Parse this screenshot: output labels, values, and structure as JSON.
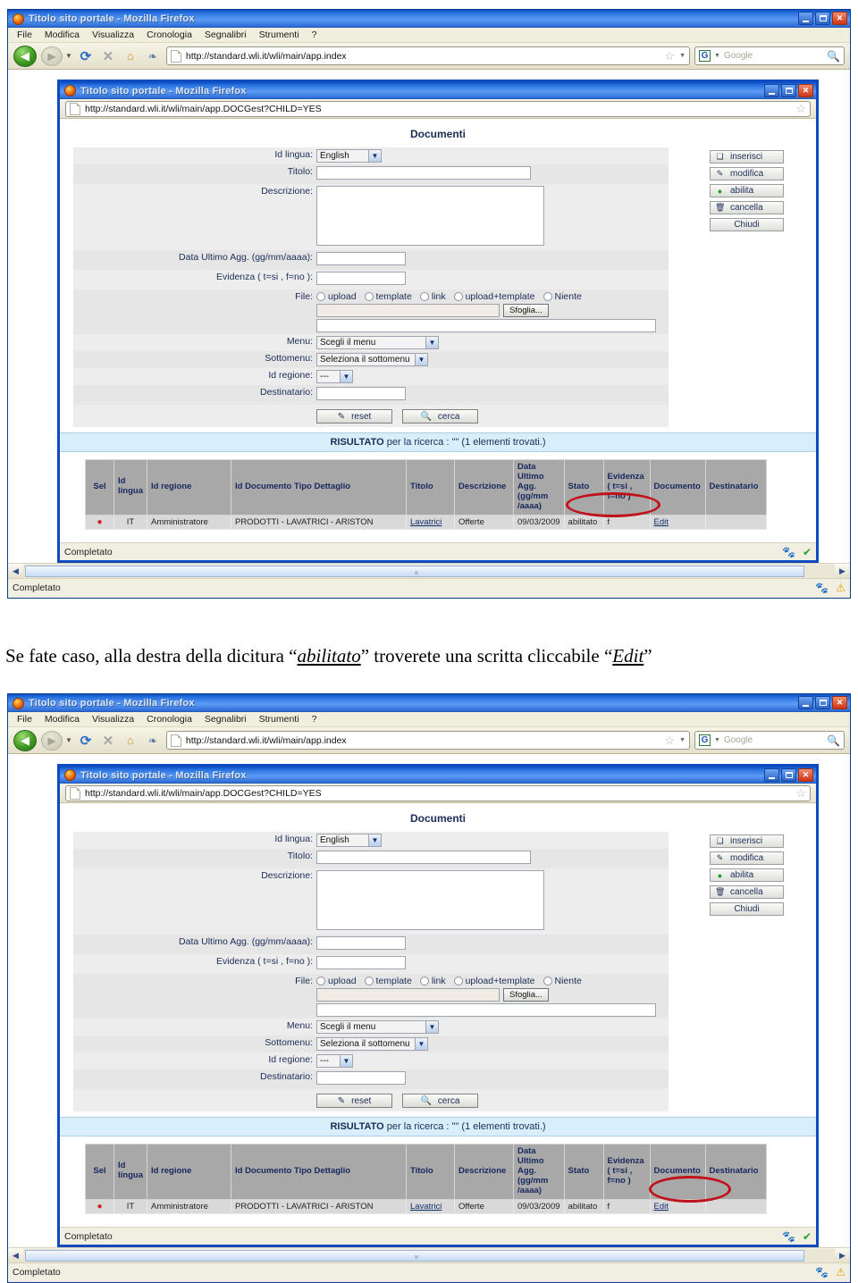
{
  "browser": {
    "window_title": "Titolo sito portale - Mozilla Firefox",
    "menubar": [
      "File",
      "Modifica",
      "Visualizza",
      "Cronologia",
      "Segnalibri",
      "Strumenti",
      "?"
    ],
    "url": "http://standard.wli.it/wli/main/app.index",
    "search_placeholder": "Google",
    "status_text": "Completato",
    "nav_icons": {
      "back": "back-arrow-icon",
      "forward": "forward-arrow-icon",
      "reload": "reload-icon",
      "stop": "stop-icon",
      "home": "home-icon",
      "bookmarks": "bookmarks-icon",
      "star": "star-icon",
      "search": "magnifier-icon",
      "throbber": "throbber-icon"
    },
    "window_buttons": [
      "minimize",
      "maximize",
      "close"
    ]
  },
  "popup": {
    "window_title": "Titolo sito portale - Mozilla Firefox",
    "url": "http://standard.wli.it/wli/main/app.DOCGest?CHILD=YES",
    "status_text": "Completato"
  },
  "page": {
    "heading": "Documenti",
    "form": {
      "fields": [
        {
          "label": "Id lingua:",
          "type": "select",
          "value": "English"
        },
        {
          "label": "Titolo:",
          "type": "text",
          "value": ""
        },
        {
          "label": "Descrizione:",
          "type": "textarea",
          "value": ""
        },
        {
          "label": "Data Ultimo Agg. (gg/mm/aaaa):",
          "type": "text",
          "value": ""
        },
        {
          "label": "Evidenza ( t=si , f=no ):",
          "type": "text",
          "value": ""
        },
        {
          "label": "File:",
          "type": "radios",
          "value": ""
        },
        {
          "label": "Menu:",
          "type": "select",
          "value": "Scegli il menu"
        },
        {
          "label": "Sottomenu:",
          "type": "select",
          "value": "Seleziona il sottomenu"
        },
        {
          "label": "Id regione:",
          "type": "select",
          "value": "---"
        },
        {
          "label": "Destinatario:",
          "type": "text",
          "value": ""
        }
      ],
      "file_options": [
        "upload",
        "template",
        "link",
        "upload+template",
        "Niente"
      ],
      "browse_label": "Sfoglia...",
      "file_value": "",
      "link_value": "",
      "reset_label": "reset",
      "search_label": "cerca"
    },
    "actions": [
      {
        "label": "inserisci",
        "icon": "new-document-icon"
      },
      {
        "label": "modifica",
        "icon": "edit-pencil-icon"
      },
      {
        "label": "abilita",
        "icon": "enable-icon"
      },
      {
        "label": "cancella",
        "icon": "trash-icon"
      },
      {
        "label": "Chiudi",
        "icon": ""
      }
    ],
    "result_bar": {
      "bold": "RISULTATO",
      "rest": " per la ricerca : \"\" (1 elementi trovati.)"
    },
    "results_table": {
      "columns": [
        "Sel",
        "Id lingua",
        "Id regione",
        "Id Documento Tipo Dettaglio",
        "Titolo",
        "Descrizione",
        "Data Ultimo Agg. (gg/mm /aaaa)",
        "Stato",
        "Evidenza ( t=si , f=no )",
        "Documento",
        "Destinatario"
      ],
      "rows": [
        {
          "sel": "●",
          "id_lingua": "IT",
          "id_regione": "Amministratore",
          "id_documento": "PRODOTTI - LAVATRICI - ARISTON",
          "titolo": "Lavatrici",
          "descrizione": "Offerte",
          "data": "09/03/2009",
          "stato": "abilitato",
          "evidenza": "f",
          "documento": "Edit",
          "destinatario": ""
        }
      ]
    }
  },
  "caption": {
    "part1": "Se fate caso, alla destra della dicitura “",
    "em1": "abilitato",
    "part2": "” troverete una scritta cliccabile “",
    "em2": "Edit",
    "part3": "”"
  },
  "annotations": {
    "top_circle_target": "abilitato",
    "bottom_circle_target": "Edit",
    "circle_color": "#c0121a"
  }
}
